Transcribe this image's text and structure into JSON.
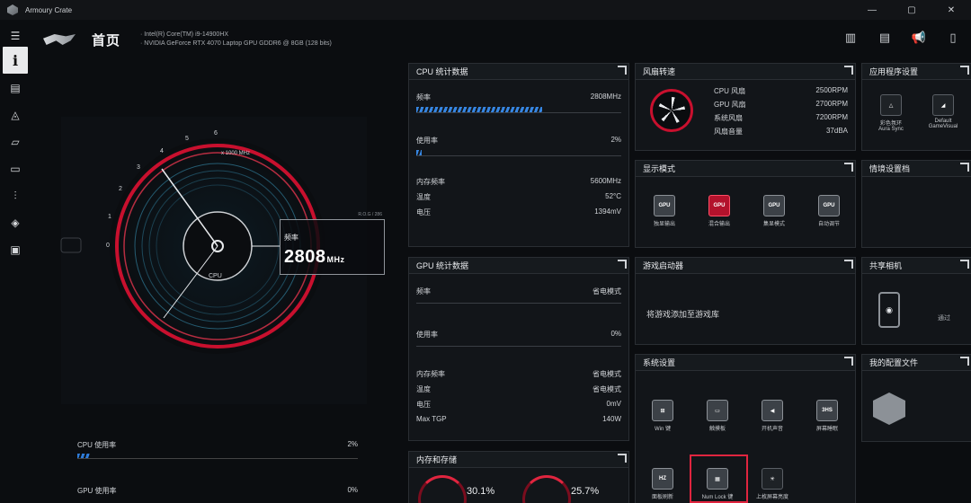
{
  "window": {
    "title": "Armoury Crate",
    "minimize": "—",
    "maximize": "▢",
    "close": "✕"
  },
  "header": {
    "page_title": "首页",
    "cpu_info": "·  Intel(R) Core(TM) i9-14900HX",
    "gpu_info": "·  NVIDIA GeForce RTX 4070 Laptop GPU GDDR6 @ 8GB (128 bits)"
  },
  "gauge": {
    "scale_label": "x 1000 MHz",
    "ticks": [
      "0",
      "1",
      "2",
      "3",
      "4",
      "5",
      "6"
    ],
    "center_label": "CPU",
    "frequency_caption": "频率",
    "frequency_value": "2808",
    "frequency_unit": "MHz",
    "tag": "R.O.G / 286"
  },
  "cpu_usage_bars": [
    {
      "label": "CPU 使用率",
      "value": "2%",
      "fraction": 0.02
    },
    {
      "label": "GPU 使用率",
      "value": "0%",
      "fraction": 0.0
    }
  ],
  "cpu_panel": {
    "title": "CPU 统计数据",
    "rows": [
      {
        "label": "频率",
        "value": "2808MHz",
        "fraction": 0.47
      },
      {
        "label": "使用率",
        "value": "2%",
        "fraction": 0.02
      },
      {
        "label": "内存频率",
        "value": "5600MHz"
      },
      {
        "label": "温度",
        "value": "52°C"
      },
      {
        "label": "电压",
        "value": "1394mV"
      }
    ]
  },
  "gpu_panel": {
    "title": "GPU 统计数据",
    "rows": [
      {
        "label": "频率",
        "value": "省电模式"
      },
      {
        "label": "使用率",
        "value": "0%"
      },
      {
        "label": "内存频率",
        "value": "省电模式"
      },
      {
        "label": "温度",
        "value": "省电模式"
      },
      {
        "label": "电压",
        "value": "0mV"
      },
      {
        "label": "Max TGP",
        "value": "140W"
      }
    ]
  },
  "memory_panel": {
    "title": "内存和存储",
    "mem_pct": "30.1%",
    "storage_pct": "25.7%"
  },
  "fan_panel": {
    "title": "风扇转速",
    "rows": [
      {
        "label": "CPU 风扇",
        "value": "2500RPM"
      },
      {
        "label": "GPU 风扇",
        "value": "2700RPM"
      },
      {
        "label": "系统风扇",
        "value": "7200RPM"
      },
      {
        "label": "风扇音量",
        "value": "37dBA"
      }
    ]
  },
  "display_panel": {
    "title": "显示模式",
    "items": [
      {
        "label": "独显输出",
        "icon": "GPU"
      },
      {
        "label": "混合输出",
        "icon": "GPU"
      },
      {
        "label": "集显模式",
        "icon": "GPU"
      },
      {
        "label": "自动调节",
        "icon": "GPU"
      }
    ]
  },
  "game_panel": {
    "title": "游戏启动器",
    "text": "将游戏添加至游戏库"
  },
  "system_panel": {
    "title": "系统设置",
    "items": [
      {
        "label": "Win 键"
      },
      {
        "label": "触摸板"
      },
      {
        "label": "开机声音"
      },
      {
        "label": "屏幕睡眠",
        "icon": "3HS"
      },
      {
        "label": "面板刷新",
        "icon": "HZ"
      },
      {
        "label": "Num Lock 键"
      },
      {
        "label": "上枚屏幕亮度"
      }
    ]
  },
  "app_settings_panel": {
    "title": "应用程序设置",
    "items": [
      {
        "label": "彩色氛环",
        "sub": "Aura Sync"
      },
      {
        "label": "Default",
        "sub": "GameVisual"
      }
    ]
  },
  "scenario_panel": {
    "title": "情境设置档"
  },
  "camera_panel": {
    "title": "共享相机",
    "text": "通过"
  },
  "profile_panel": {
    "title": "我的配置文件"
  }
}
